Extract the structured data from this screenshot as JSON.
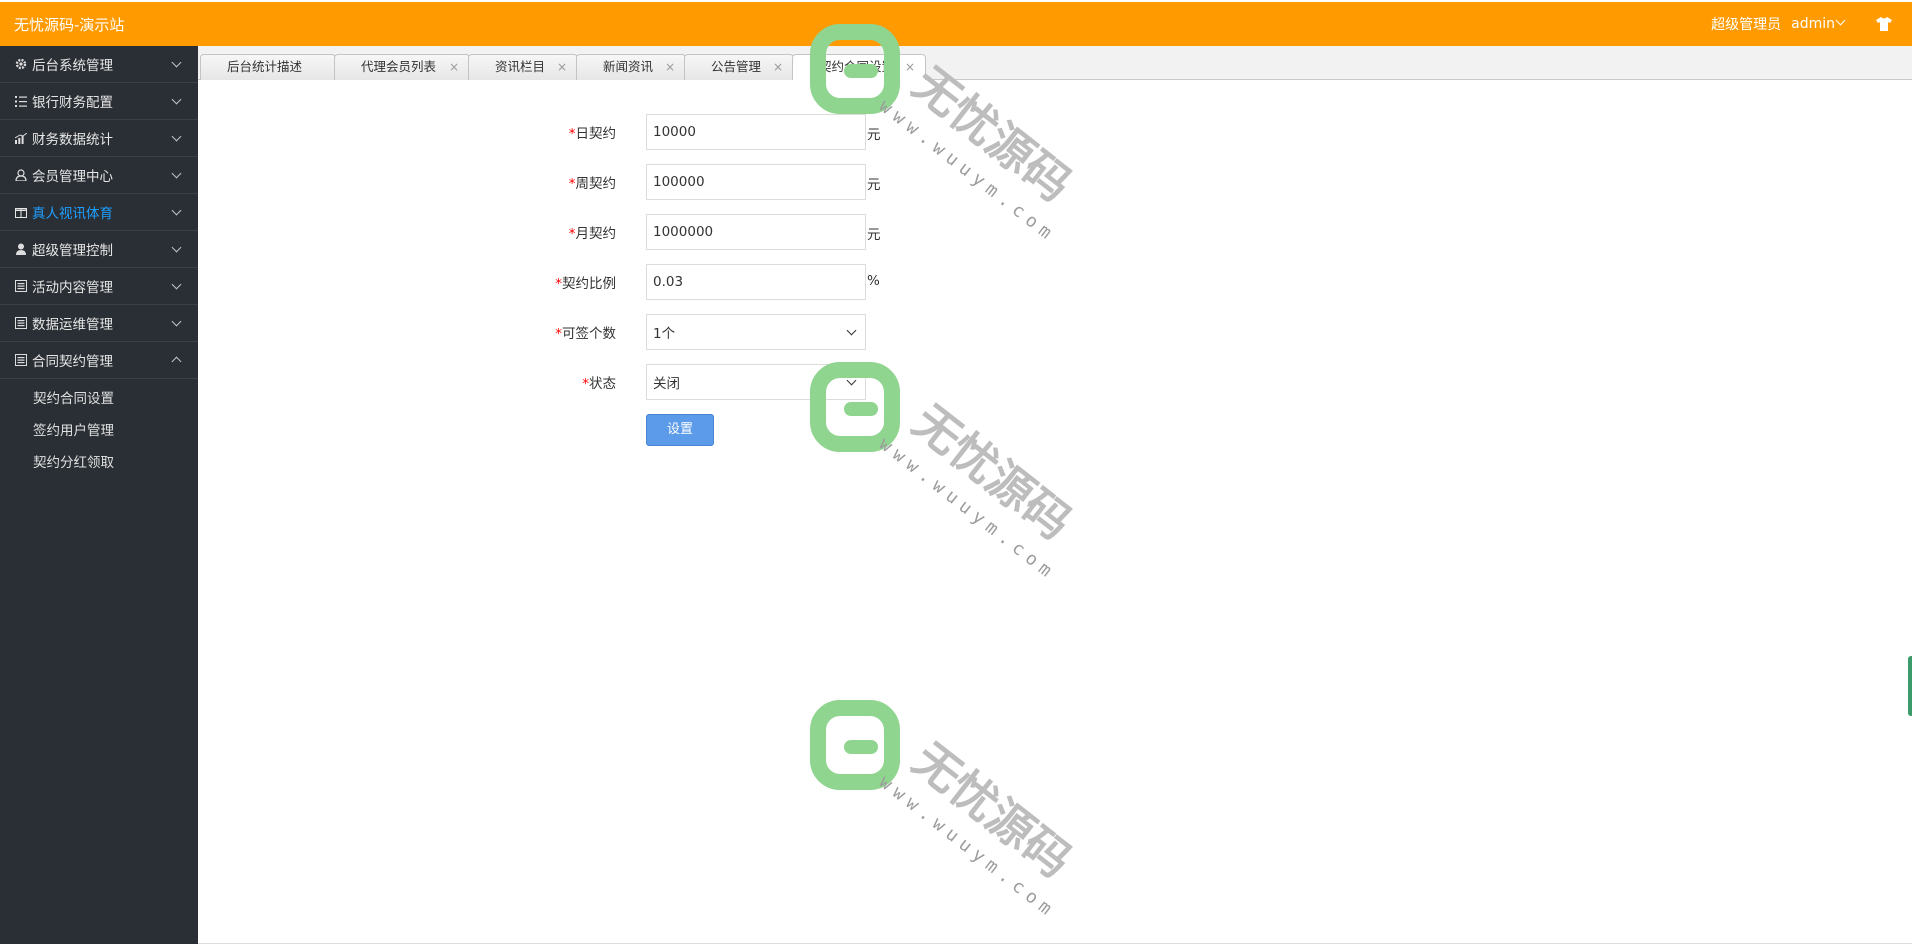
{
  "header": {
    "brand": "无忧源码-演示站",
    "role": "超级管理员",
    "username": "admin"
  },
  "sidebar": {
    "items": [
      {
        "label": "后台系统管理",
        "icon": "gear-icon"
      },
      {
        "label": "银行财务配置",
        "icon": "list-icon"
      },
      {
        "label": "财务数据统计",
        "icon": "chart-icon"
      },
      {
        "label": "会员管理中心",
        "icon": "user-icon"
      },
      {
        "label": "真人视讯体育",
        "icon": "gift-icon",
        "active": true
      },
      {
        "label": "超级管理控制",
        "icon": "user-solid-icon"
      },
      {
        "label": "活动内容管理",
        "icon": "doc-icon"
      },
      {
        "label": "数据运维管理",
        "icon": "doc-icon"
      },
      {
        "label": "合同契约管理",
        "icon": "doc-icon",
        "expanded": true
      }
    ],
    "subitems": [
      "契约合同设置",
      "签约用户管理",
      "契约分红领取"
    ]
  },
  "tabs": [
    "后台统计描述",
    "代理会员列表",
    "资讯栏目",
    "新闻资讯",
    "公告管理",
    "契约合同设置"
  ],
  "form": {
    "daily_label": "日契约",
    "daily_value": "10000",
    "daily_unit": "元",
    "weekly_label": "周契约",
    "weekly_value": "100000",
    "weekly_unit": "元",
    "monthly_label": "月契约",
    "monthly_value": "1000000",
    "monthly_unit": "元",
    "ratio_label": "契约比例",
    "ratio_value": "0.03",
    "ratio_unit": "%",
    "count_label": "可签个数",
    "count_value": "1个",
    "status_label": "状态",
    "status_value": "关闭",
    "required_mark": "*",
    "submit_label": "设置"
  },
  "watermark": {
    "text": "无忧源码",
    "url": "www.wuuym.com",
    "color": "#8fd48f"
  },
  "colors": {
    "header": "#ff9b00",
    "sidebar": "#2a2f35",
    "active": "#1e9fff",
    "button": "#5b9bea"
  }
}
